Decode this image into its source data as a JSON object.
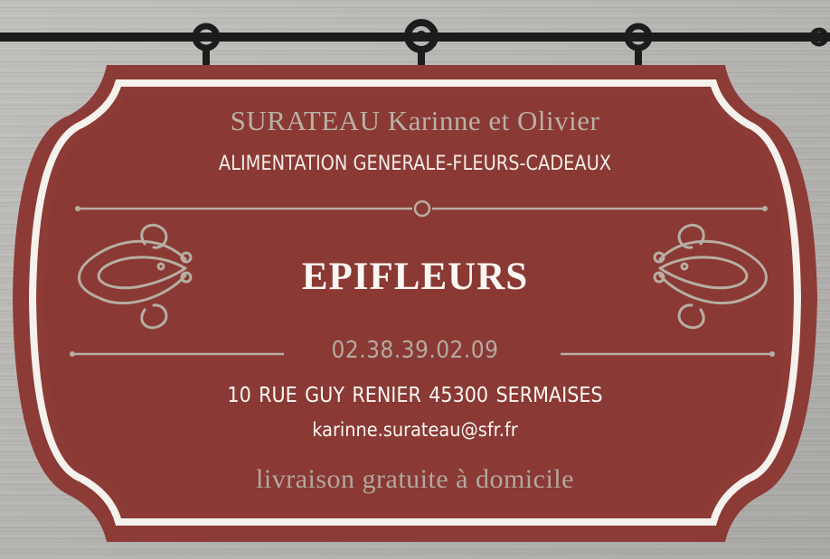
{
  "sign": {
    "owners": "SURATEAU Karinne et Olivier",
    "activity": "ALIMENTATION GENERALE-FLEURS-CADEAUX",
    "shop_name": "EPIFLEURS",
    "phone": "02.38.39.02.09",
    "address": "10 RUE GUY RENIER  45300 SERMAISES",
    "email": "karinne.surateau@sfr.fr",
    "delivery": "livraison gratuite à domicile"
  },
  "colors": {
    "sign_red": "#8c3b36",
    "frame_white": "#f5f1ec",
    "ornament_gray": "#b7aea3",
    "wood_gray": "#b8b6b2",
    "rail_black": "#1c1c1c"
  }
}
